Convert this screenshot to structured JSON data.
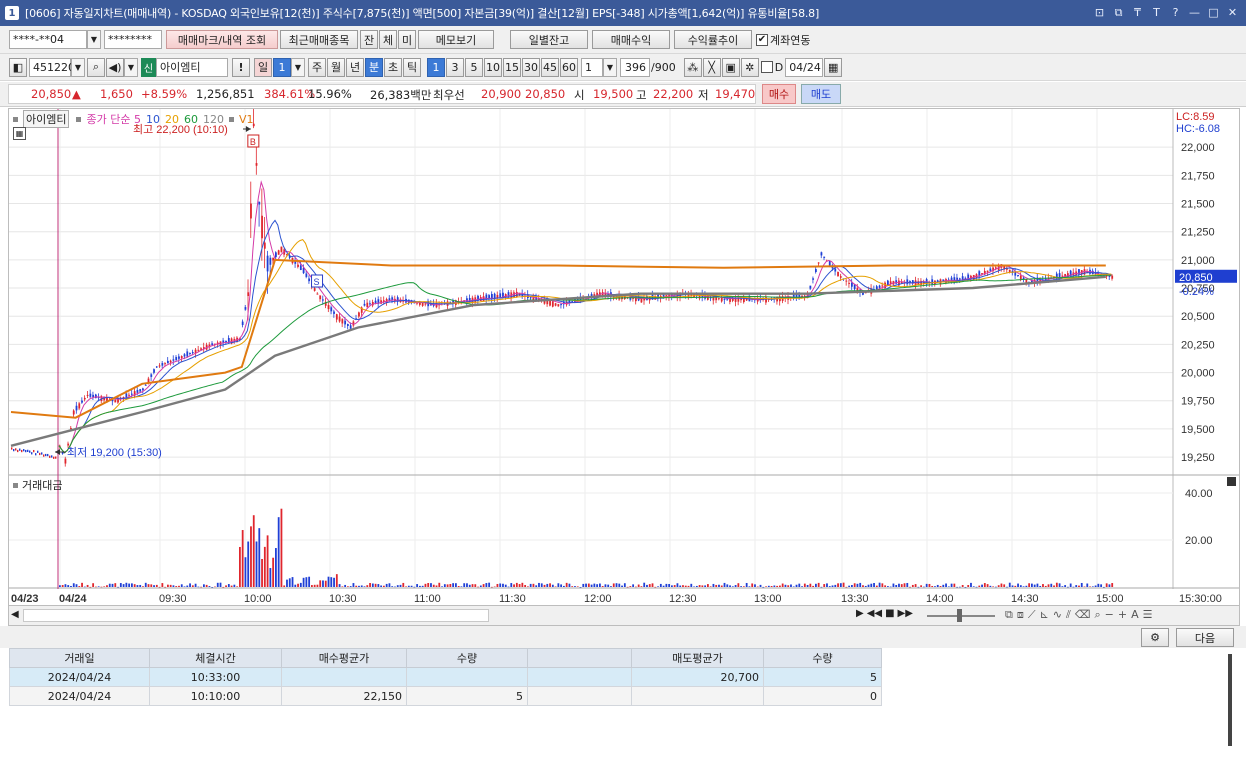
{
  "window": {
    "number": "1",
    "title": "[0606] 자동일지차트(매매내역) - KOSDAQ 외국인보유[12(천)] 주식수[7,875(천)] 액면[500] 자본금[39(억)] 결산[12월] EPS[-348] 시가총액[1,642(억)] 유통비율[58.8]",
    "controls": [
      "⊡",
      "⧉",
      "₸",
      "T",
      "?",
      "—",
      "□",
      "✕"
    ]
  },
  "toolbar1": {
    "account": "****-**04",
    "password": "********",
    "trade_mark_btn": "매매마크/내역 조회",
    "recent_btn": "최근매매종목",
    "mode_btns": [
      "잔",
      "체",
      "미"
    ],
    "memo_btn": "메모보기",
    "daily_balance_btn": "일별잔고",
    "trade_profit_btn": "매매수익",
    "return_trend_btn": "수익률추이",
    "account_link_label": "계좌연동",
    "account_link_checked": true
  },
  "toolbar2": {
    "code": "451220",
    "credit_tag": "신",
    "stock_name": "아이엠티",
    "alert_btn": "!",
    "period_btns": [
      "일",
      "1",
      "주",
      "월",
      "년",
      "분",
      "초",
      "틱"
    ],
    "active_period": "분",
    "interval_btns": [
      "1",
      "3",
      "5",
      "10",
      "15",
      "30",
      "45",
      "60"
    ],
    "active_interval": "1",
    "count_value": "1",
    "display_count": "396",
    "display_total": "/900",
    "d_label": "D",
    "date": "04/24"
  },
  "ticker": {
    "price": "20,850",
    "arrow": "▲",
    "change": "1,650",
    "change_rate": "+8.59%",
    "volume": "1,256,851",
    "vol_ratio": "384.61%",
    "turnover": "15.96%",
    "amount": "26,383백만",
    "best_ask_label": "최우선",
    "best_ask": "20,900",
    "best_bid": "20,850",
    "open_label": "시",
    "open": "19,500",
    "high_label": "고",
    "high": "22,200",
    "low_label": "저",
    "low": "19,470",
    "buy_btn": "매수",
    "sell_btn": "매도"
  },
  "chart": {
    "stock_tab": "아이엠티",
    "legend": [
      {
        "label": "종가 단순 5",
        "color": "#d43ba8"
      },
      {
        "label": "10",
        "color": "#2c54d0"
      },
      {
        "label": "20",
        "color": "#e6a000"
      },
      {
        "label": "60",
        "color": "#1d9a3c"
      },
      {
        "label": "120",
        "color": "#888888"
      },
      {
        "label": "V1",
        "color": "#e07a10"
      }
    ],
    "high_annotation": "최고 22,200 (10:10)",
    "low_annotation": "최저 19,200 (15:30)",
    "buy_mark": "B",
    "sell_mark": "S",
    "lc": "LC:8.59",
    "hc": "HC:-6.08",
    "current_price_tag": "20,850",
    "current_pct_tag": "-0.24%",
    "y_ticks": [
      "22,000",
      "21,750",
      "21,500",
      "21,250",
      "21,000",
      "20,750",
      "20,500",
      "20,250",
      "20,000",
      "19,750",
      "19,500",
      "19,250"
    ],
    "volume_title": "거래대금",
    "volume_ticks": [
      "40.00",
      "20.00"
    ],
    "x_labels": [
      "04/23",
      "04/24",
      "09:30",
      "10:00",
      "10:30",
      "11:00",
      "11:30",
      "12:00",
      "12:30",
      "13:00",
      "13:30",
      "14:00",
      "14:30",
      "15:00",
      "15:30:00"
    ],
    "colors": {
      "up": "#e0262d",
      "down": "#1f3fd6",
      "vwap": "#e07a10",
      "ma120": "#7a7a7a"
    }
  },
  "chart_data": {
    "type": "candlestick",
    "title": "",
    "y_range": [
      19100,
      22250
    ],
    "price_path": [
      [
        "09:00",
        19350
      ],
      [
        "09:02",
        19220
      ],
      [
        "09:05",
        19650
      ],
      [
        "09:10",
        19800
      ],
      [
        "09:20",
        19750
      ],
      [
        "09:30",
        19850
      ],
      [
        "09:35",
        20050
      ],
      [
        "09:45",
        20150
      ],
      [
        "09:55",
        20250
      ],
      [
        "10:05",
        20300
      ],
      [
        "10:08",
        20700
      ],
      [
        "10:10",
        22200
      ],
      [
        "10:12",
        21500
      ],
      [
        "10:15",
        20950
      ],
      [
        "10:20",
        21100
      ],
      [
        "10:28",
        20900
      ],
      [
        "10:33",
        20700
      ],
      [
        "10:40",
        20500
      ],
      [
        "10:45",
        20400
      ],
      [
        "10:50",
        20600
      ],
      [
        "11:00",
        20650
      ],
      [
        "11:15",
        20600
      ],
      [
        "11:30",
        20650
      ],
      [
        "11:45",
        20700
      ],
      [
        "12:00",
        20600
      ],
      [
        "12:15",
        20700
      ],
      [
        "12:30",
        20650
      ],
      [
        "12:45",
        20700
      ],
      [
        "13:00",
        20650
      ],
      [
        "13:15",
        20650
      ],
      [
        "13:30",
        20680
      ],
      [
        "13:35",
        21050
      ],
      [
        "13:42",
        20850
      ],
      [
        "13:50",
        20700
      ],
      [
        "14:00",
        20800
      ],
      [
        "14:15",
        20800
      ],
      [
        "14:30",
        20850
      ],
      [
        "14:40",
        20950
      ],
      [
        "14:50",
        20800
      ],
      [
        "15:00",
        20850
      ],
      [
        "15:10",
        20900
      ],
      [
        "15:20",
        20850
      ]
    ],
    "series": [
      {
        "name": "V1",
        "values": [
          [
            9.0,
            19650
          ],
          [
            9.1,
            19600
          ],
          [
            9.5,
            19900
          ],
          [
            10.0,
            20000
          ],
          [
            10.1,
            20050
          ],
          [
            10.3,
            21000
          ],
          [
            11.0,
            20950
          ],
          [
            12.0,
            20950
          ],
          [
            13.0,
            20930
          ],
          [
            14.0,
            20950
          ],
          [
            15.3,
            20950
          ]
        ]
      },
      {
        "name": "120",
        "values": [
          [
            9.0,
            19350
          ],
          [
            9.5,
            19650
          ],
          [
            10.0,
            19850
          ],
          [
            10.3,
            20150
          ],
          [
            10.8,
            20400
          ],
          [
            11.5,
            20600
          ],
          [
            12.5,
            20700
          ],
          [
            13.5,
            20700
          ],
          [
            14.5,
            20750
          ],
          [
            15.3,
            20850
          ]
        ]
      }
    ],
    "events": [
      {
        "time": "10:10",
        "type": "buy",
        "price": 22150,
        "qty": 5
      },
      {
        "time": "10:33",
        "type": "sell",
        "price": 20700,
        "qty": 5
      }
    ]
  },
  "bottom": {
    "next_btn": "다음",
    "columns": [
      "거래일",
      "체결시간",
      "매수평균가",
      "수량",
      "",
      "매도평균가",
      "수량"
    ],
    "rows": [
      [
        "2024/04/24",
        "10:33:00",
        "",
        "",
        "",
        "20,700",
        "5"
      ],
      [
        "2024/04/24",
        "10:10:00",
        "22,150",
        "5",
        "",
        "",
        "0"
      ]
    ]
  }
}
